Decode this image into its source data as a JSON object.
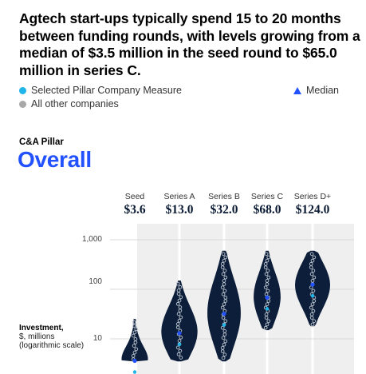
{
  "headline": "Agtech start-ups typically spend 15 to 20 months between funding rounds, with levels growing from a median of $3.5 million in the seed round to $65.0 million in series C.",
  "legend": {
    "selected": "Selected Pillar Company Measure",
    "others": "All other companies",
    "median": "Median",
    "selected_color": "#1fb5e8",
    "others_color": "#a8a8a8",
    "median_color": "#2251ff"
  },
  "pillar": {
    "label": "C&A Pillar",
    "title": "Overall"
  },
  "chart_data": {
    "type": "violin",
    "yscale": "log",
    "ylabel": "Investment, $, millions (logarithmic scale)",
    "ylabel_bold": "Investment,",
    "ylabel_line2": "$, millions",
    "ylabel_line3": "(logarithmic scale)",
    "yticks": [
      10,
      100,
      1000
    ],
    "ytick_labels": [
      "10",
      "100",
      "1,000"
    ],
    "ylim": [
      3.5,
      1500
    ],
    "violin_color": "#0c1e3a",
    "band_color": "#efefef",
    "categories": [
      "Seed",
      "Series A",
      "Series B",
      "Series C",
      "Series D+"
    ],
    "median_labels": [
      "$3.6",
      "$13.0",
      "$32.0",
      "$68.0",
      "$124.0"
    ],
    "medians": [
      3.6,
      13.0,
      32.0,
      68.0,
      124.0
    ],
    "ranges": [
      [
        3.5,
        25
      ],
      [
        3.5,
        150
      ],
      [
        3.5,
        600
      ],
      [
        15,
        600
      ],
      [
        18,
        600
      ]
    ]
  }
}
